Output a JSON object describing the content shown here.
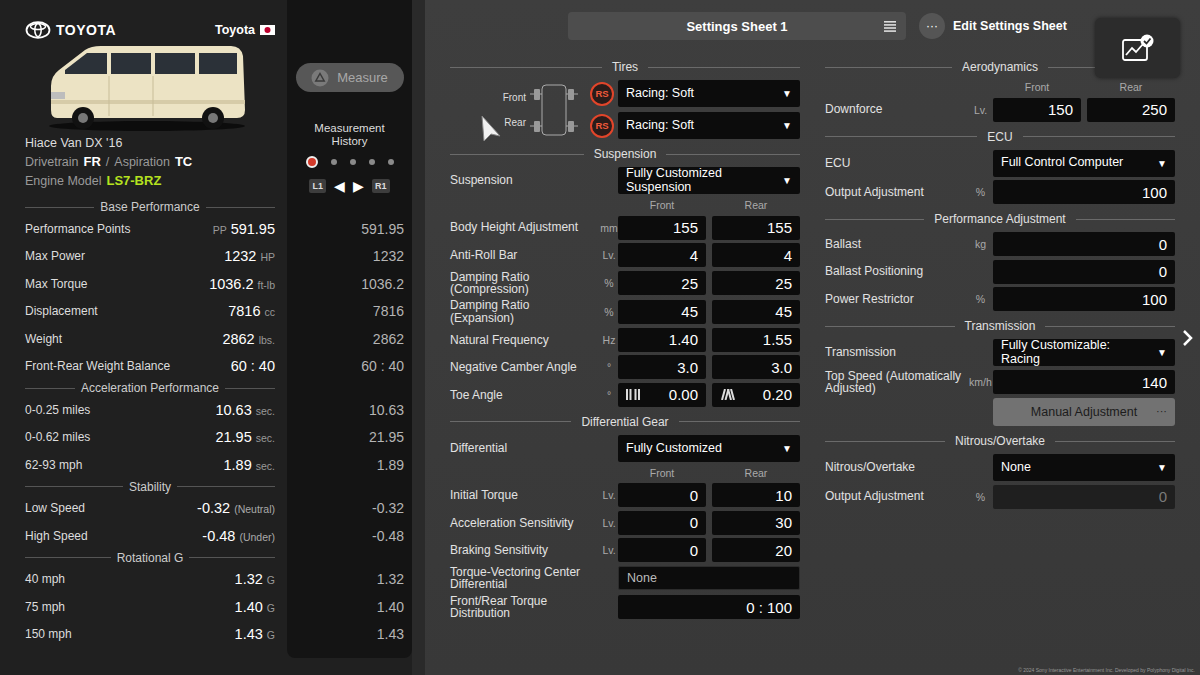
{
  "car": {
    "brand": "TOYOTA",
    "maker": "Toyota",
    "name": "Hiace Van DX '16",
    "specs": [
      {
        "label": "Drivetrain",
        "value": "FR"
      },
      {
        "label": "Aspiration",
        "value": "TC"
      }
    ],
    "separator": "/",
    "engine_label": "Engine Model",
    "engine": "LS7-BRZ"
  },
  "measure": {
    "label": "Measure",
    "history_title": "Measurement History",
    "slots": [
      {
        "selected": true
      },
      {
        "selected": false
      },
      {
        "selected": false
      },
      {
        "selected": false
      },
      {
        "selected": false
      }
    ],
    "controls": [
      "L1",
      "◀",
      "▶",
      "R1"
    ]
  },
  "performance": [
    {
      "title": "Base Performance",
      "rows": [
        {
          "label": "Performance Points",
          "prefix": "PP",
          "value": "591.95",
          "history": "591.95"
        },
        {
          "label": "Max Power",
          "value": "1232",
          "unit": "HP",
          "history": "1232"
        },
        {
          "label": "Max Torque",
          "value": "1036.2",
          "unit": "ft-lb",
          "history": "1036.2"
        },
        {
          "label": "Displacement",
          "value": "7816",
          "unit": "cc",
          "history": "7816"
        },
        {
          "label": "Weight",
          "value": "2862",
          "unit": "lbs.",
          "history": "2862"
        },
        {
          "label": "Front-Rear Weight Balance",
          "value": "60 : 40",
          "history": "60 : 40"
        }
      ]
    },
    {
      "title": "Acceleration Performance",
      "rows": [
        {
          "label": "0-0.25 miles",
          "value": "10.63",
          "unit": "sec.",
          "history": "10.63"
        },
        {
          "label": "0-0.62 miles",
          "value": "21.95",
          "unit": "sec.",
          "history": "21.95"
        },
        {
          "label": "62-93 mph",
          "value": "1.89",
          "unit": "sec.",
          "history": "1.89"
        }
      ]
    },
    {
      "title": "Stability",
      "rows": [
        {
          "label": "Low Speed",
          "value": "-0.32",
          "note": "(Neutral)",
          "history": "-0.32"
        },
        {
          "label": "High Speed",
          "value": "-0.48",
          "note": "(Under)",
          "history": "-0.48"
        }
      ]
    },
    {
      "title": "Rotational G",
      "rows": [
        {
          "label": "40 mph",
          "value": "1.32",
          "unit": "G",
          "history": "1.32"
        },
        {
          "label": "75 mph",
          "value": "1.40",
          "unit": "G",
          "history": "1.40"
        },
        {
          "label": "150 mph",
          "value": "1.43",
          "unit": "G",
          "history": "1.43"
        }
      ]
    }
  ],
  "settings_sheet": {
    "title": "Settings Sheet 1"
  },
  "edit": {
    "icon": "···",
    "label": "Edit Settings Sheet"
  },
  "tires": {
    "title": "Tires",
    "items": [
      {
        "position": "Front",
        "badge": "RS",
        "value": "Racing: Soft",
        "arrow": "▼"
      },
      {
        "position": "Rear",
        "badge": "RS",
        "value": "Racing: Soft",
        "arrow": "▼"
      }
    ]
  },
  "middle_sections": [
    {
      "title": "Suspension",
      "rows": [
        {
          "kind": "select",
          "label": "Suspension",
          "value": "Fully Customized Suspension",
          "arrow": "▼"
        },
        {
          "kind": "headers",
          "front": "Front",
          "rear": "Rear"
        },
        {
          "kind": "pair",
          "label": "Body Height Adjustment",
          "unit": "mm",
          "front": "155",
          "rear": "155"
        },
        {
          "kind": "pair",
          "label": "Anti-Roll Bar",
          "unit": "Lv.",
          "front": "4",
          "rear": "4"
        },
        {
          "kind": "pair",
          "label": "Damping Ratio (Compression)",
          "unit": "%",
          "front": "25",
          "rear": "25"
        },
        {
          "kind": "pair",
          "label": "Damping Ratio (Expansion)",
          "unit": "%",
          "front": "45",
          "rear": "45"
        },
        {
          "kind": "pair",
          "label": "Natural Frequency",
          "unit": "Hz",
          "front": "1.40",
          "rear": "1.55"
        },
        {
          "kind": "pair",
          "label": "Negative Camber Angle",
          "unit": "°",
          "front": "3.0",
          "rear": "3.0"
        },
        {
          "kind": "toe",
          "label": "Toe Angle",
          "unit": "°",
          "front": "0.00",
          "rear": "0.20"
        }
      ]
    },
    {
      "title": "Differential Gear",
      "rows": [
        {
          "kind": "select",
          "label": "Differential",
          "value": "Fully Customized",
          "arrow": "▼"
        },
        {
          "kind": "headers",
          "front": "Front",
          "rear": "Rear"
        },
        {
          "kind": "pair",
          "label": "Initial Torque",
          "unit": "Lv.",
          "front": "0",
          "rear": "10"
        },
        {
          "kind": "pair",
          "label": "Acceleration Sensitivity",
          "unit": "Lv.",
          "front": "0",
          "rear": "30"
        },
        {
          "kind": "pair",
          "label": "Braking Sensitivity",
          "unit": "Lv.",
          "front": "0",
          "rear": "20"
        },
        {
          "kind": "info",
          "label": "Torque-Vectoring Center Differential",
          "value": "None"
        },
        {
          "kind": "single",
          "label": "Front/Rear Torque Distribution",
          "value": "0 : 100",
          "disabled": false
        }
      ]
    }
  ],
  "right_sections": [
    {
      "title": "Aerodynamics",
      "rows": [
        {
          "kind": "headers",
          "front": "Front",
          "rear": "Rear"
        },
        {
          "kind": "pair",
          "label": "Downforce",
          "unit": "Lv.",
          "front": "150",
          "rear": "250"
        }
      ]
    },
    {
      "title": "ECU",
      "rows": [
        {
          "kind": "select",
          "label": "ECU",
          "value": "Full Control Computer",
          "arrow": "▼"
        },
        {
          "kind": "single",
          "label": "Output Adjustment",
          "unit": "%",
          "value": "100",
          "disabled": false
        }
      ]
    },
    {
      "title": "Performance Adjustment",
      "rows": [
        {
          "kind": "single",
          "label": "Ballast",
          "unit": "kg",
          "value": "0",
          "disabled": false
        },
        {
          "kind": "single",
          "label": "Ballast Positioning",
          "value": "0",
          "disabled": false
        },
        {
          "kind": "single",
          "label": "Power Restrictor",
          "unit": "%",
          "value": "100",
          "disabled": false
        }
      ]
    },
    {
      "title": "Transmission",
      "rows": [
        {
          "kind": "select",
          "label": "Transmission",
          "value": "Fully Customizable: Racing",
          "arrow": "▼"
        },
        {
          "kind": "single",
          "label": "Top Speed (Automatically Adjusted)",
          "unit": "km/h",
          "value": "140",
          "disabled": false
        },
        {
          "kind": "button",
          "value": "Manual Adjustment",
          "icon": "···"
        }
      ]
    },
    {
      "title": "Nitrous/Overtake",
      "rows": [
        {
          "kind": "select",
          "label": "Nitrous/Overtake",
          "value": "None",
          "arrow": "▼"
        },
        {
          "kind": "single",
          "label": "Output Adjustment",
          "unit": "%",
          "value": "0",
          "disabled": true
        }
      ]
    }
  ],
  "copyright": "© 2024 Sony Interactive Entertainment Inc. Developed by Polyphony Digital Inc."
}
